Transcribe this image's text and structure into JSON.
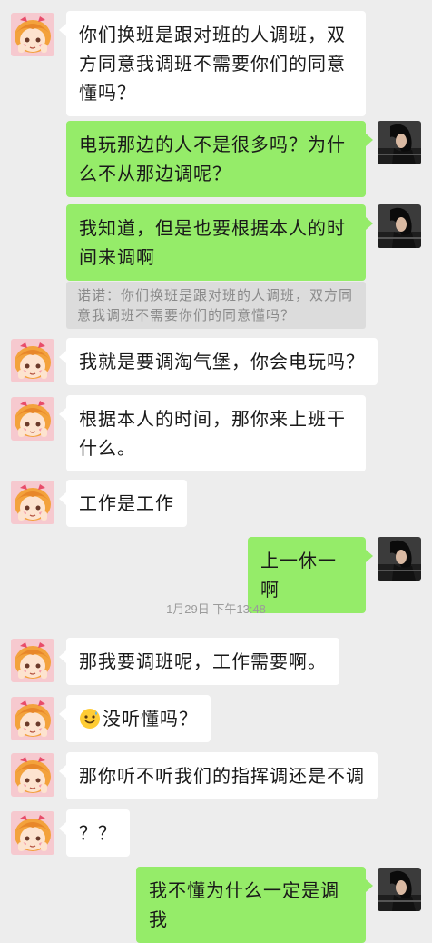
{
  "messages": [
    {
      "side": "left",
      "text": "你们换班是跟对班的人调班，双方同意我调班不需要你们的同意懂吗？"
    },
    {
      "side": "right",
      "text": "电玩那边的人不是很多吗？为什么不从那边调呢？"
    },
    {
      "side": "right",
      "text": "我知道，但是也要根据本人的时间来调啊"
    },
    {
      "quote": "诺诺：你们换班是跟对班的人调班，双方同意我调班不需要你们的同意懂吗？"
    },
    {
      "side": "left",
      "text": "我就是要调淘气堡，你会电玩吗？"
    },
    {
      "side": "left",
      "text": "根据本人的时间，那你来上班干什么。"
    },
    {
      "side": "left",
      "text": "工作是工作"
    },
    {
      "side": "right",
      "text": "上一休一啊"
    },
    {
      "timestamp": "1月29日 下午13:48"
    },
    {
      "side": "left",
      "text": "那我要调班呢，工作需要啊。"
    },
    {
      "side": "left",
      "text": "没听懂吗？",
      "emoji": "sweat-smile-emoji"
    },
    {
      "side": "left",
      "text": "那你听不听我们的指挥调还是不调"
    },
    {
      "side": "left",
      "text": "？？"
    },
    {
      "side": "right",
      "text": "我不懂为什么一定是调我"
    }
  ],
  "colors": {
    "background": "#ededed",
    "bubble_left": "#ffffff",
    "bubble_right": "#95ec69",
    "quote_bg": "#dcdcdc"
  },
  "icons": {
    "left_avatar": "cartoon-girl-avatar",
    "right_avatar": "dark-hair-photo-avatar"
  }
}
